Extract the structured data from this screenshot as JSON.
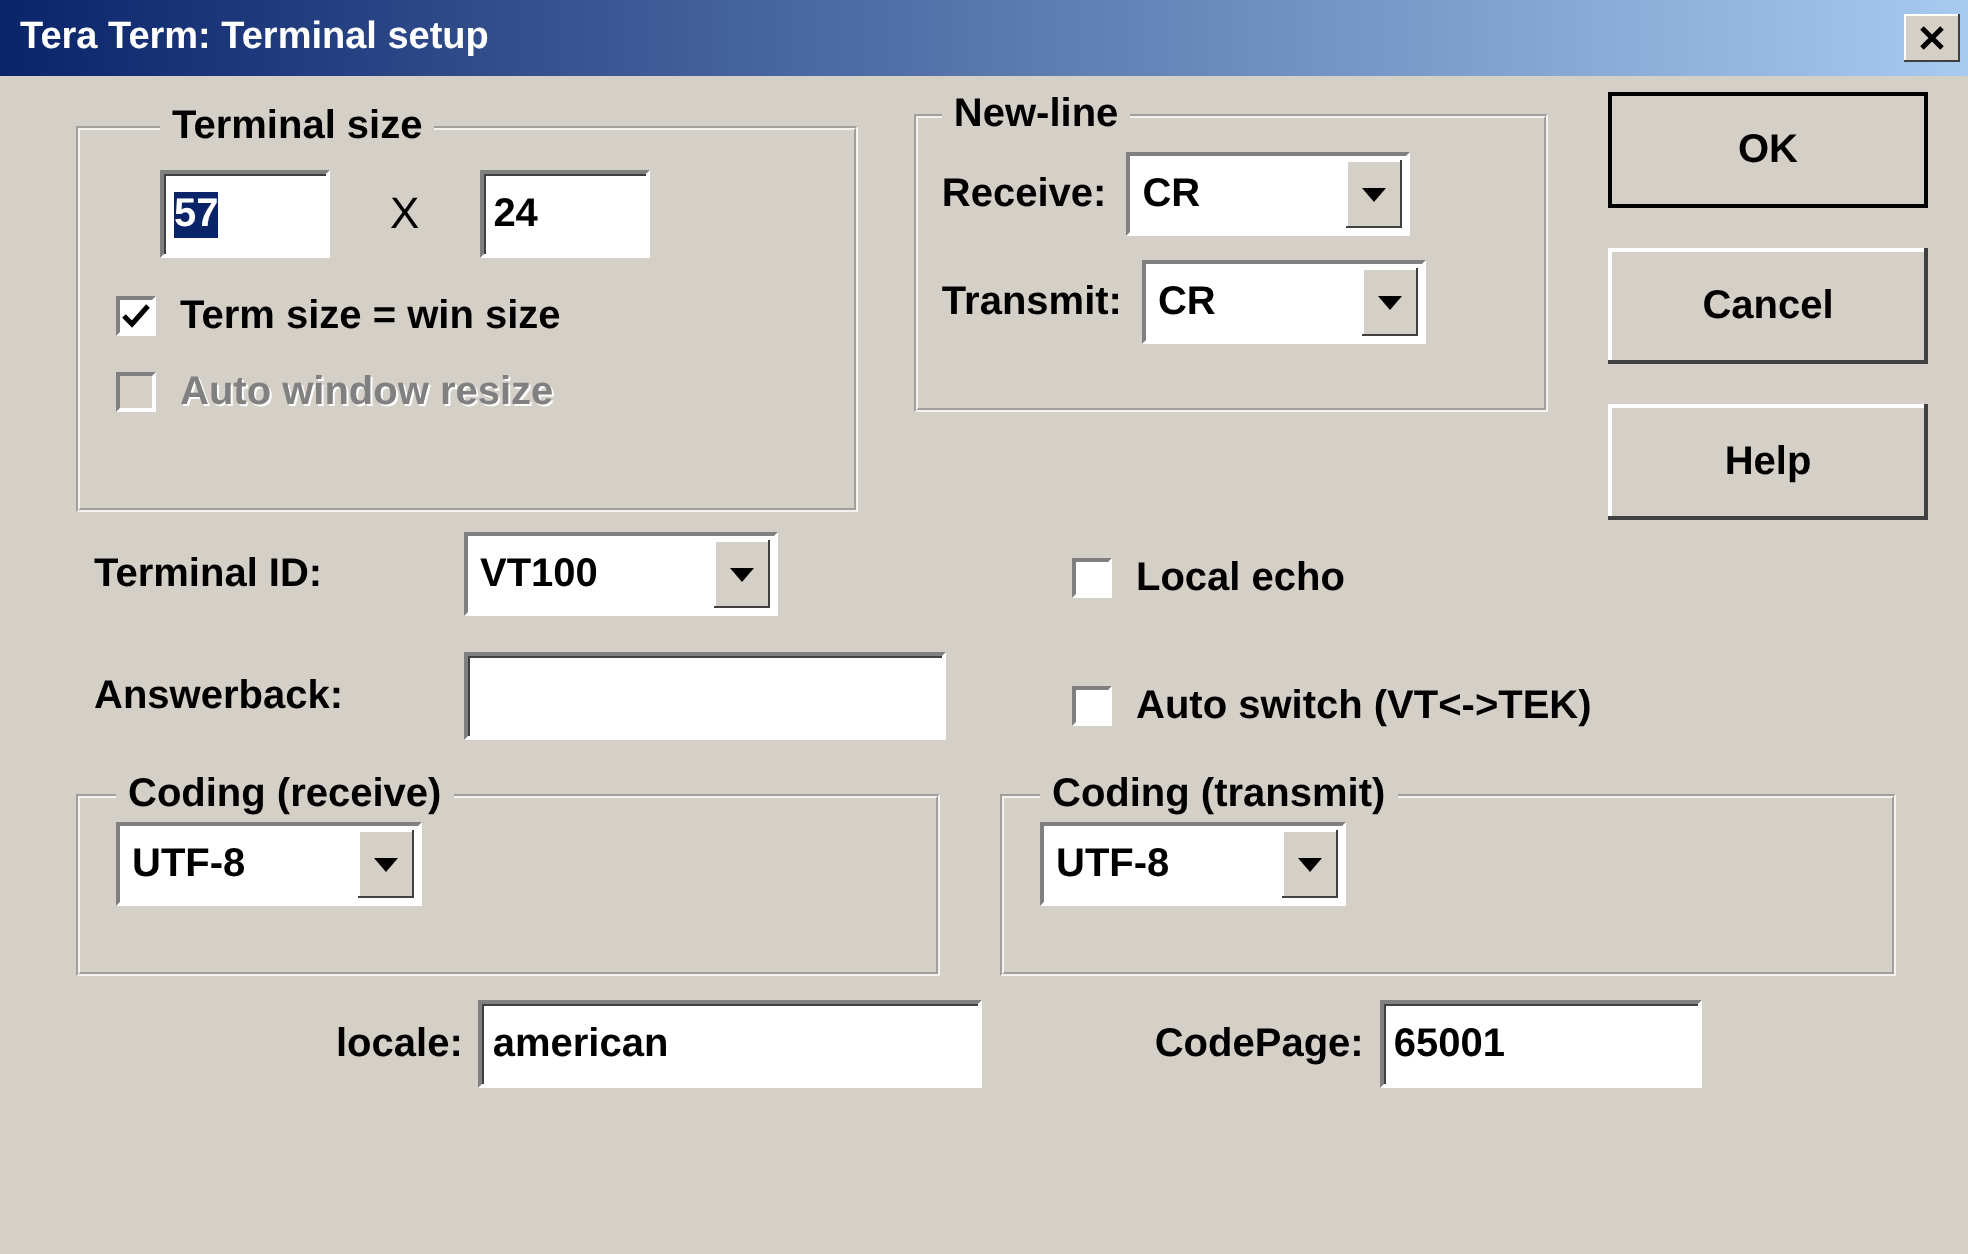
{
  "window": {
    "title": "Tera Term: Terminal setup"
  },
  "terminal_size": {
    "label": "Terminal size",
    "columns": "57",
    "columns_text_selected": true,
    "times": "X",
    "rows": "24",
    "checkboxes": [
      {
        "label": "Term size = win size",
        "checked": true,
        "disabled": false
      },
      {
        "label": "Auto window resize",
        "checked": false,
        "disabled": true
      }
    ]
  },
  "new_line": {
    "label": "New-line",
    "receive_label": "Receive:",
    "receive": "CR",
    "transmit_label": "Transmit:",
    "transmit": "CR"
  },
  "buttons": [
    "OK",
    "Cancel",
    "Help"
  ],
  "terminal_id": {
    "label": "Terminal ID:",
    "value": "VT100"
  },
  "answerback": {
    "label": "Answerback:"
  },
  "options": [
    {
      "label": "Local echo",
      "checked": false
    },
    {
      "label": "Auto switch (VT<->TEK)",
      "checked": false
    }
  ],
  "coding_receive": {
    "label": "Coding (receive)",
    "value": "UTF-8"
  },
  "coding_transmit": {
    "label": "Coding (transmit)",
    "value": "UTF-8"
  },
  "locale": {
    "label": "locale:",
    "value": "american"
  },
  "codepage": {
    "label": "CodePage:",
    "value": "65001"
  }
}
